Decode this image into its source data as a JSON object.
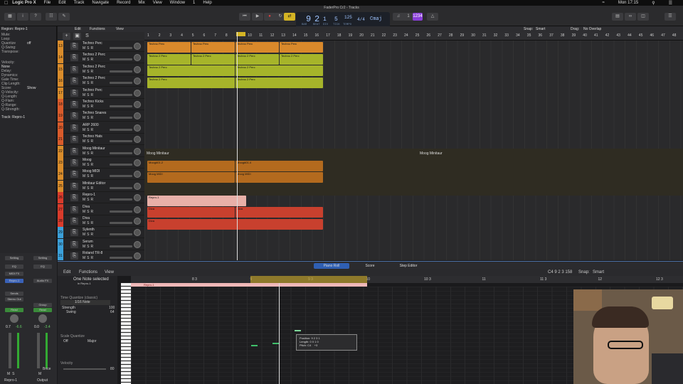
{
  "menubar": {
    "app": "Logic Pro X",
    "items": [
      "File",
      "Edit",
      "Track",
      "Navigate",
      "Record",
      "Mix",
      "View",
      "Window",
      "1",
      "Help"
    ],
    "clock": "Mon 17:15"
  },
  "window": {
    "title": "FaderPro Cr2 - Tracks"
  },
  "lcd": {
    "bar": "9",
    "beat": "2",
    "division": "1",
    "tick": "5",
    "tempo": "125",
    "tempo_label": "KEEP",
    "timesig": "4/4",
    "key": "Cmaj",
    "bar_label": "BAR",
    "beat_label": "BEAT",
    "div_label": "DIV",
    "tick_label": "TICK",
    "tempo_label2": "TEMPO",
    "cpu": "1234"
  },
  "inspector": {
    "region": "Region: Repro-1",
    "rows": [
      {
        "k": "Mute:",
        "v": ""
      },
      {
        "k": "Loop:",
        "v": ""
      },
      {
        "k": "Quantize",
        "v": "off"
      },
      {
        "k": "Q-Swing:",
        "v": ""
      },
      {
        "k": "Transpose:",
        "v": ""
      },
      {
        "k": "Velocity:",
        "v": ""
      },
      {
        "k": "Delay:",
        "v": ""
      },
      {
        "k": "Dynamics:",
        "v": ""
      },
      {
        "k": "Gate Time:",
        "v": ""
      },
      {
        "k": "Clip Length:",
        "v": ""
      },
      {
        "k": "Score:",
        "v": "Show"
      },
      {
        "k": "Q-Velocity:",
        "v": ""
      },
      {
        "k": "Q-Length:",
        "v": ""
      },
      {
        "k": "Q-Flam:",
        "v": ""
      },
      {
        "k": "Q-Range:",
        "v": ""
      },
      {
        "k": "Q-Strength:",
        "v": ""
      }
    ],
    "more": "More",
    "none": "None",
    "track": "Track: Repro-1"
  },
  "main_header": {
    "edit": "Edit",
    "functions": "Functions",
    "view": "View",
    "snap_label": "Snap:",
    "snap": "Smart",
    "drag_label": "Drag:",
    "drag": "No Overlap"
  },
  "ruler": [
    "1",
    "2",
    "3",
    "4",
    "5",
    "6",
    "7",
    "8",
    "9",
    "10",
    "11",
    "12",
    "13",
    "14",
    "15",
    "16",
    "17",
    "18",
    "19",
    "20",
    "21",
    "22",
    "23",
    "24",
    "25",
    "26",
    "27",
    "28",
    "29",
    "30",
    "31",
    "32",
    "33",
    "34",
    "35",
    "36",
    "37",
    "38",
    "39",
    "40",
    "41",
    "42",
    "43",
    "44",
    "45",
    "46",
    "47",
    "48",
    "49"
  ],
  "tracks": [
    {
      "n": "13",
      "name": "Techno Perc",
      "color": "#d98c2b"
    },
    {
      "n": "14",
      "name": "Techno 2 Perc",
      "color": "#d98c2b"
    },
    {
      "n": "15",
      "name": "Techno 2 Perc",
      "color": "#d98c2b"
    },
    {
      "n": "16",
      "name": "Techno 2 Perc",
      "color": "#d98c2b"
    },
    {
      "n": "17",
      "name": "Techno Perc",
      "color": "#d98c2b"
    },
    {
      "n": "18",
      "name": "Techno Kicks",
      "color": "#d95b2b"
    },
    {
      "n": "19",
      "name": "Techno Snares",
      "color": "#d95b2b"
    },
    {
      "n": "20",
      "name": "ARP 2600",
      "color": "#d95b2b"
    },
    {
      "n": "21",
      "name": "Techno Hats",
      "color": "#d95b2b"
    },
    {
      "n": "22",
      "name": "Moog Minitaur",
      "color": "#d98c2b"
    },
    {
      "n": "23",
      "name": "Moog",
      "color": "#d98c2b"
    },
    {
      "n": "24",
      "name": "Moog MIDI",
      "color": "#d98c2b"
    },
    {
      "n": "25",
      "name": "Minitaur Editor",
      "color": "#d98c2b"
    },
    {
      "n": "26",
      "name": "Repro-1",
      "color": "#d93b2b"
    },
    {
      "n": "27",
      "name": "Diva",
      "color": "#d93b2b"
    },
    {
      "n": "28",
      "name": "Diva",
      "color": "#d93b2b"
    },
    {
      "n": "29",
      "name": "Sylenth",
      "color": "#3ba0d9"
    },
    {
      "n": "30",
      "name": "Serum",
      "color": "#3ba0d9"
    },
    {
      "n": "31",
      "name": "Roland TR-8",
      "color": "#3ba0d9"
    }
  ],
  "regions": {
    "r1": "Techno Perc",
    "r2": "Techno 2 Perc",
    "folder": "Moog Minitaur",
    "moog": "Moog#01.2",
    "moog2": "Moog#01.4",
    "moogmidi": "Moog MIDI",
    "repro": "Repro-1",
    "diva": "Diva"
  },
  "tabs": [
    "Piano Roll",
    "Score",
    "Step Editor"
  ],
  "piano_roll": {
    "edit": "Edit",
    "functions": "Functions",
    "view": "View",
    "selected": "One Note selected",
    "selected_sub": "in Repro-1",
    "tq_label": "Time Quantize (classic)",
    "tq": "1/16 Note",
    "strength_label": "Strength",
    "strength": "100",
    "swing_label": "Swing",
    "swing": "64",
    "sq_label": "Scale Quantize",
    "sq_off": "Off",
    "sq_major": "Major",
    "velocity_label": "Velocity",
    "velocity": "80",
    "region_name": "Repro-1",
    "snap_label": "Snap:",
    "snap": "Smart",
    "pos_readout": "C4  9 2 3 158",
    "ruler": [
      "8 3",
      "9",
      "9 3",
      "10",
      "10 3",
      "11",
      "11 3",
      "12",
      "12 3"
    ]
  },
  "tooltip": {
    "position_label": "Position:",
    "position": "9 2 3 1",
    "length_label": "Length:",
    "length": "0 0 1 0",
    "pitch_label": "Pitch:",
    "pitch": "C4",
    "delta": "+3"
  },
  "mixer": {
    "setting": "Setting",
    "eq": "EQ",
    "midi_fx": "MIDI FX",
    "repro": "Repro-1",
    "audio_fx": "Audio FX",
    "sends": "Sends",
    "stereo_out": "Stereo Out",
    "group": "Group",
    "read": "Read",
    "vol1": "0.7",
    "pan1": "-6.6",
    "vol2": "0.0",
    "pan2": "-3.4",
    "name1": "Repro-1",
    "name2": "Output",
    "bnce": "Bnce"
  }
}
